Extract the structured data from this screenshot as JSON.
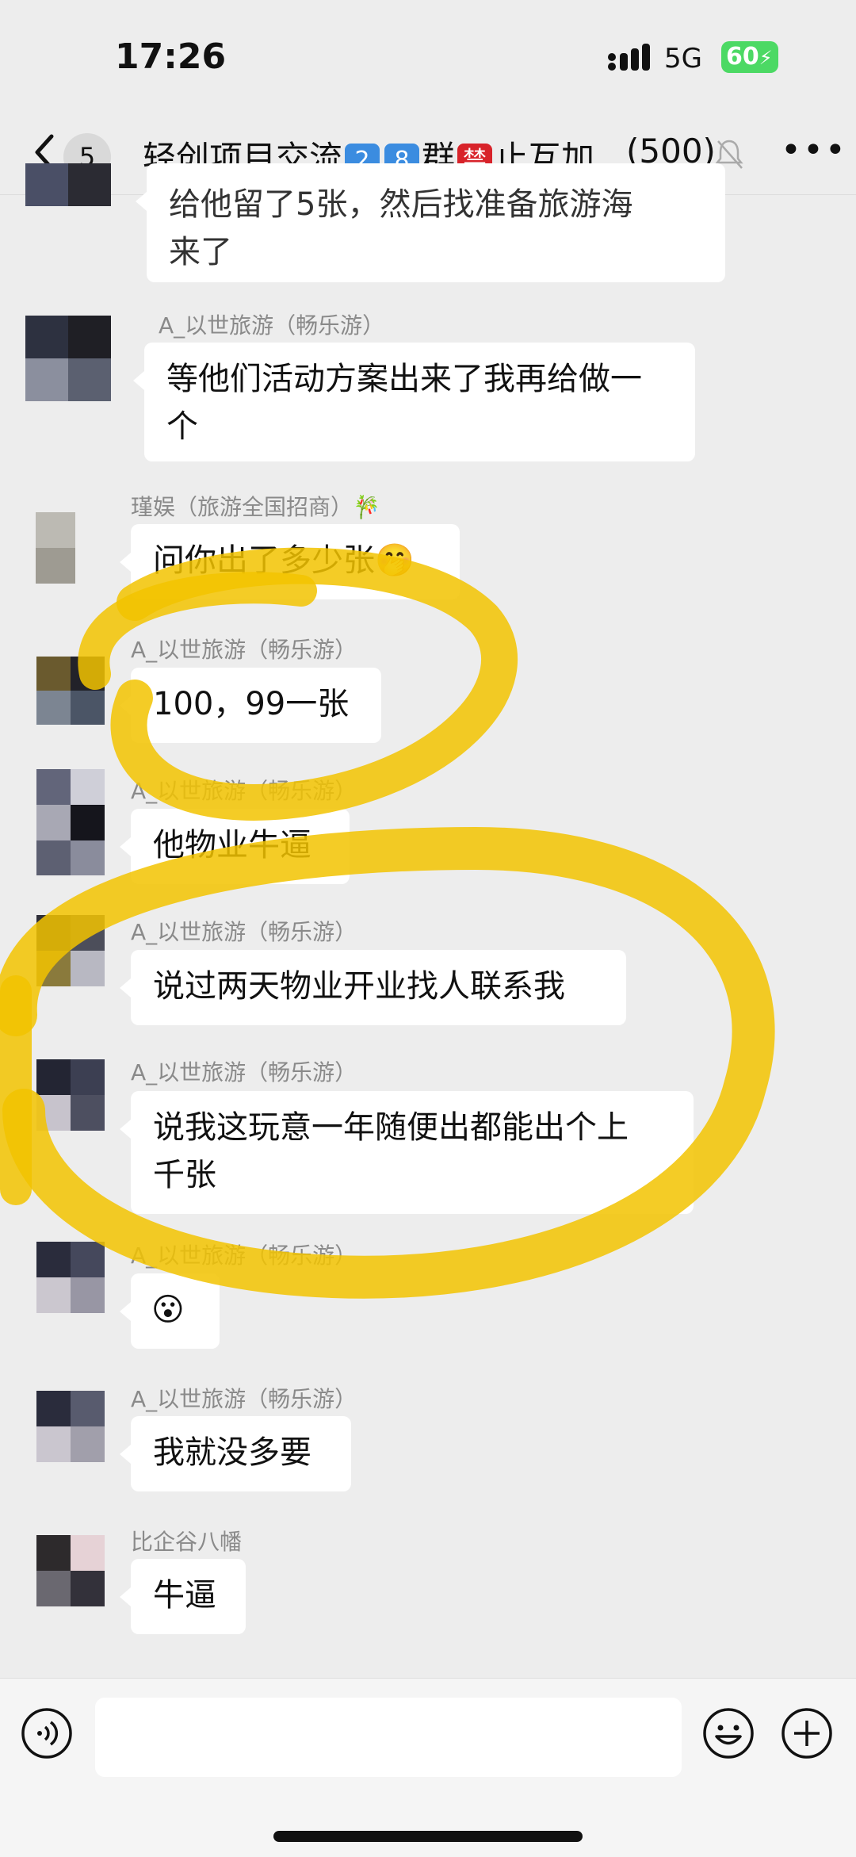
{
  "status": {
    "time": "17:26",
    "network": "5G",
    "battery": "60"
  },
  "header": {
    "back_count": "5",
    "title_part1": "轻创项目交流",
    "emoji1": "2",
    "emoji2": "8",
    "title_part2": "群",
    "emoji3": "禁",
    "title_part3": "止互加",
    "member_count": "(500)"
  },
  "messages": [
    {
      "sender": "",
      "text": "给他留了5张，然后找准备旅游海\n来了"
    },
    {
      "sender": "A_以世旅游（畅乐游）",
      "text": "等他们活动方案出来了我再给做一\n个"
    },
    {
      "sender": "瑾娱（旅游全国招商）",
      "sender_suffix": "🎋",
      "text": "问你出了多少张",
      "emoji": "🤭"
    },
    {
      "sender": "A_以世旅游（畅乐游）",
      "text": "100，99一张"
    },
    {
      "sender": "A_以世旅游（畅乐游）",
      "text": "他物业牛逼"
    },
    {
      "sender": "A_以世旅游（畅乐游）",
      "text": "说过两天物业开业找人联系我"
    },
    {
      "sender": "A_以世旅游（畅乐游）",
      "text": "说我这玩意一年随便出都能出个上\n千张"
    },
    {
      "sender": "A_以世旅游（畅乐游）",
      "text": "",
      "emoji": "😮"
    },
    {
      "sender": "A_以世旅游（畅乐游）",
      "text": "我就没多要"
    },
    {
      "sender": "比企谷八幡",
      "text": "牛逼"
    }
  ],
  "colors": {
    "highlight": "#f2c300",
    "bubble": "#ffffff",
    "background": "#ededed"
  },
  "icons": [
    "back-icon",
    "mute-bell-icon",
    "more-icon",
    "voice-icon",
    "emoji-icon",
    "plus-icon"
  ]
}
